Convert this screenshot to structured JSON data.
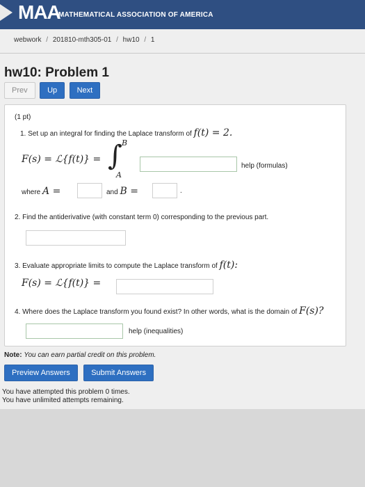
{
  "header": {
    "logo": "MAA",
    "org": "MATHEMATICAL ASSOCIATION OF AMERICA"
  },
  "breadcrumb": {
    "items": [
      "webwork",
      "201810-mth305-01",
      "hw10",
      "1"
    ],
    "separator": "/"
  },
  "page": {
    "title": "hw10: Problem 1"
  },
  "nav": {
    "prev": "Prev",
    "up": "Up",
    "next": "Next"
  },
  "problem": {
    "points": "(1 pt)",
    "q1": "1. Set up an integral for finding the Laplace transform of",
    "q1_func": "f(t) = 2.",
    "q1_lhs": "F(s) = ℒ{f(t)} =",
    "q1_upper": "B",
    "q1_lower": "A",
    "help_formulas": "help (formulas)",
    "where_a": "where",
    "a_eq": "A =",
    "and_b": "and",
    "b_eq": "B =",
    "period": ".",
    "q2": "2. Find the antiderivative (with constant term 0) corresponding to the previous part.",
    "q3": "3. Evaluate appropriate limits to compute the Laplace transform of",
    "q3_func": "f(t):",
    "q3_lhs": "F(s) = ℒ{f(t)} =",
    "q4": "4. Where does the Laplace transform you found exist? In other words, what is the domain of",
    "q4_func": "F(s)?",
    "help_inequalities": "help (inequalities)"
  },
  "note": {
    "label": "Note:",
    "text": "You can earn partial credit on this problem."
  },
  "actions": {
    "preview": "Preview Answers",
    "submit": "Submit Answers"
  },
  "status": {
    "attempted": "You have attempted this problem 0 times.",
    "remaining": "You have unlimited attempts remaining."
  },
  "colors": {
    "header": "#2f4f82",
    "button": "#2e6fc1"
  }
}
